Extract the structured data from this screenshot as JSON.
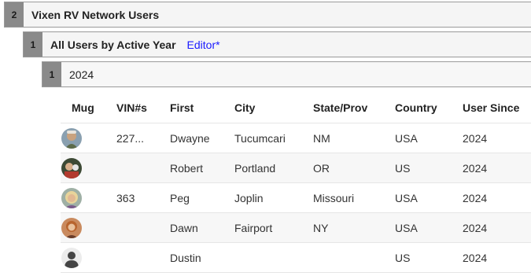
{
  "groups": {
    "level1": {
      "count": "2",
      "title": "Vixen RV Network Users"
    },
    "level2": {
      "count": "1",
      "title": "All Users by Active Year",
      "editor_link": "Editor*"
    },
    "level3": {
      "count": "1",
      "title": "2024"
    }
  },
  "table": {
    "headers": {
      "mug": "Mug",
      "vin": "VIN#s",
      "first": "First",
      "city": "City",
      "state": "State/Prov",
      "country": "Country",
      "since": "User Since"
    },
    "rows": [
      {
        "avatar": "avatar-dwayne",
        "vin": "227...",
        "first": "Dwayne",
        "city": "Tucumcari",
        "state": "NM",
        "country": "USA",
        "since": "2024"
      },
      {
        "avatar": "avatar-robert",
        "vin": "",
        "first": "Robert",
        "city": "Portland",
        "state": "OR",
        "country": "US",
        "since": "2024"
      },
      {
        "avatar": "avatar-peg",
        "vin": "363",
        "first": "Peg",
        "city": "Joplin",
        "state": "Missouri",
        "country": "USA",
        "since": "2024"
      },
      {
        "avatar": "avatar-dawn",
        "vin": "",
        "first": "Dawn",
        "city": "Fairport",
        "state": "NY",
        "country": "USA",
        "since": "2024"
      },
      {
        "avatar": "default-user-icon",
        "vin": "",
        "first": "Dustin",
        "city": "",
        "state": "",
        "country": "US",
        "since": "2024"
      }
    ]
  },
  "colors": {
    "link": "#1a1aff",
    "count_badge": "#8a8a8a",
    "group_border": "#9a9a9a"
  }
}
